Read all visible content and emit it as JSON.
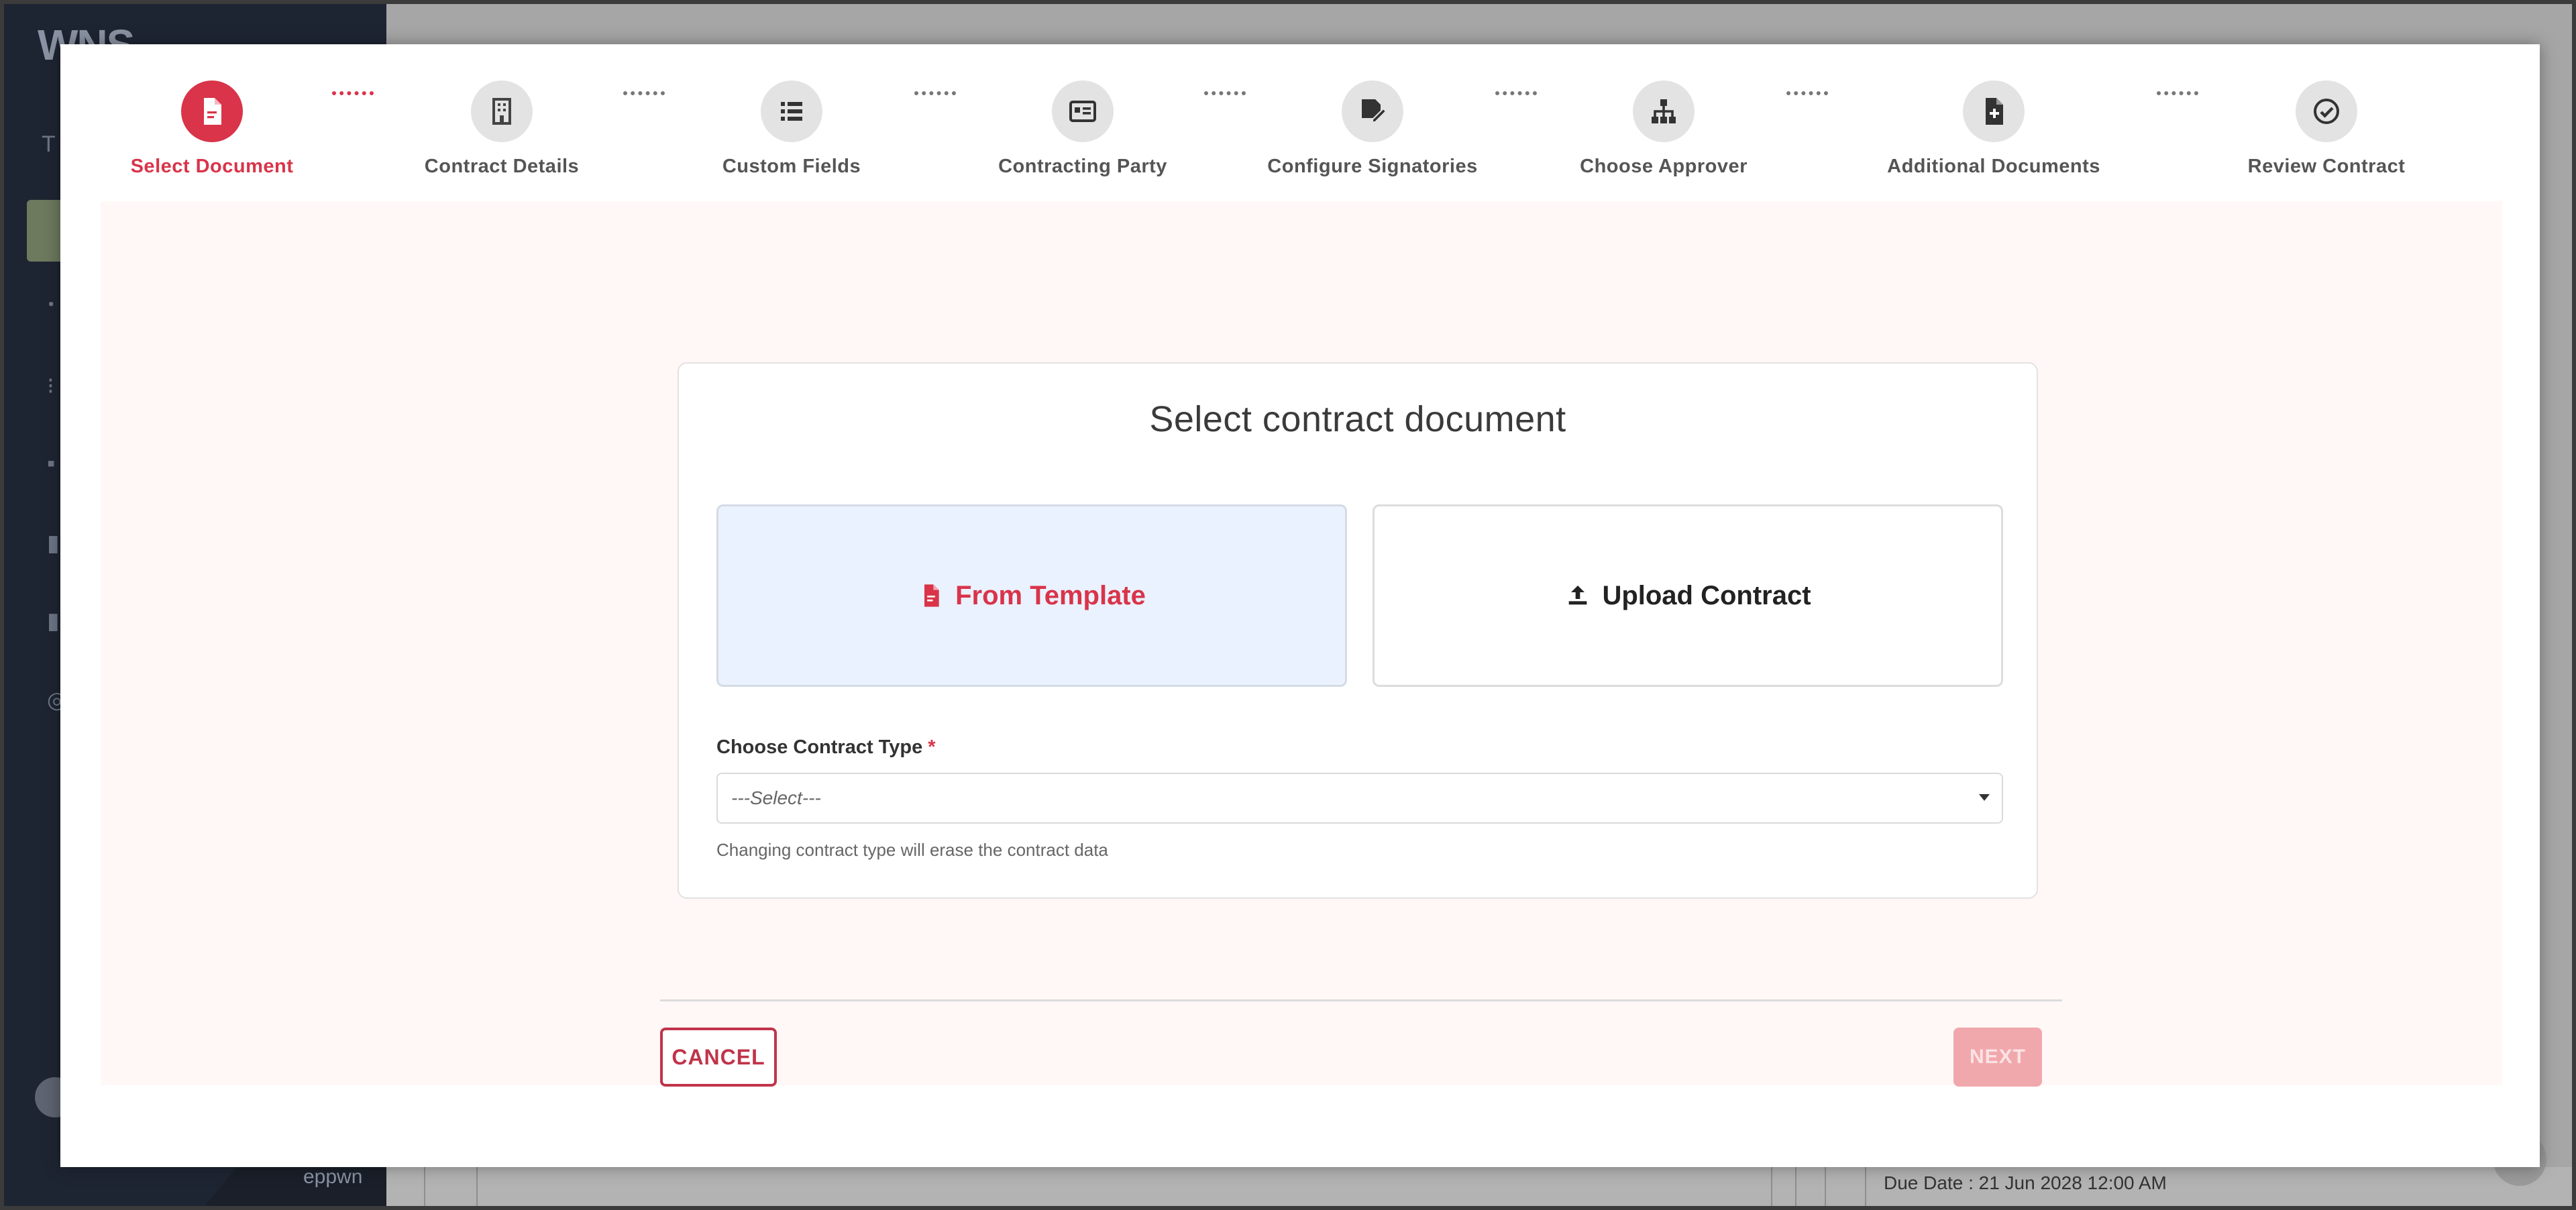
{
  "background_app": {
    "logo": "WNS",
    "user_name": "eppwn",
    "due_date": "Due Date : 21 Jun 2028 12:00 AM"
  },
  "stepper": {
    "steps": [
      {
        "label": "Select Document",
        "icon": "document-icon",
        "active": true
      },
      {
        "label": "Contract Details",
        "icon": "building-icon",
        "active": false
      },
      {
        "label": "Custom Fields",
        "icon": "list-icon",
        "active": false
      },
      {
        "label": "Contracting Party",
        "icon": "id-card-icon",
        "active": false
      },
      {
        "label": "Configure Signatories",
        "icon": "signature-icon",
        "active": false
      },
      {
        "label": "Choose Approver",
        "icon": "hierarchy-icon",
        "active": false
      },
      {
        "label": "Additional Documents",
        "icon": "file-plus-icon",
        "active": false
      },
      {
        "label": "Review Contract",
        "icon": "check-circle-icon",
        "active": false
      }
    ]
  },
  "card": {
    "title": "Select contract document",
    "options": [
      {
        "label": "From Template",
        "icon": "file-icon",
        "selected": true
      },
      {
        "label": "Upload Contract",
        "icon": "upload-icon",
        "selected": false
      }
    ],
    "contract_type": {
      "label": "Choose Contract Type",
      "required_mark": "*",
      "selected_value": "---Select---",
      "help_text": "Changing contract type will erase the contract data"
    }
  },
  "footer": {
    "cancel_label": "CANCEL",
    "next_label": "NEXT"
  },
  "colors": {
    "accent": "#d9344a",
    "selected_option_bg": "#eaf2ff",
    "content_bg": "#fff8f6",
    "sidebar_bg": "#1e2532"
  }
}
